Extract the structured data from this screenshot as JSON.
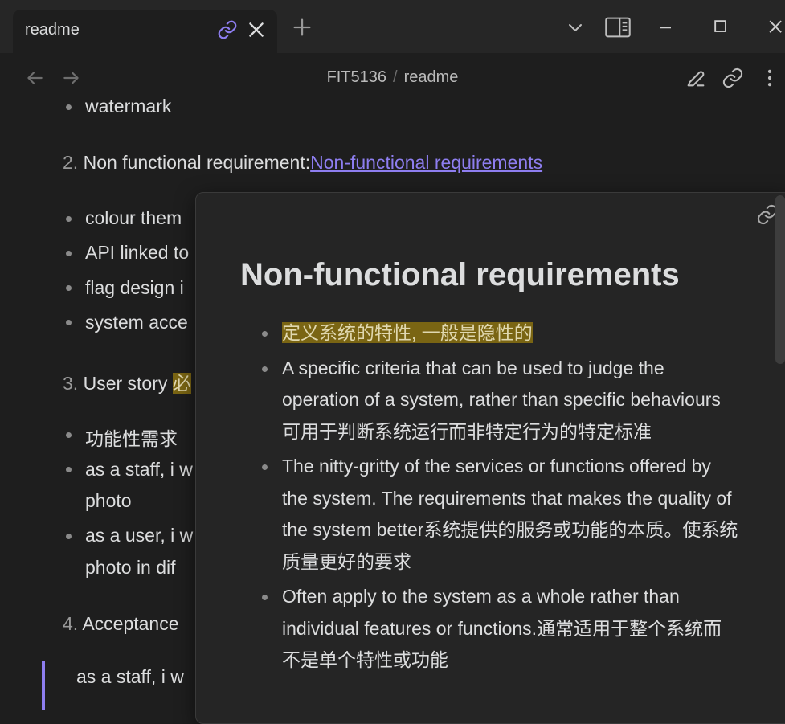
{
  "tab": {
    "title": "readme"
  },
  "breadcrumb": {
    "folder": "FIT5136",
    "separator": "/",
    "file": "readme"
  },
  "note": {
    "bullet_watermark": "watermark",
    "item2_number": "2.",
    "item2_text": "Non functional requirement:",
    "item2_link": "Non-functional requirements",
    "bullets_a": [
      "colour them",
      "API linked to",
      "flag design i",
      "system acce"
    ],
    "item3_number": "3.",
    "item3_text": "User story ",
    "item3_highlight": "必",
    "bullets_b": [
      "功能性需求"
    ],
    "bullet_staff_line1": "as a staff, i w",
    "bullet_staff_line2": "photo",
    "bullet_user_line1": "as a user, i w",
    "bullet_user_line2": "photo in dif",
    "item4_number": "4.",
    "item4_text": "Acceptance",
    "quote_text": "as a staff, i w"
  },
  "preview": {
    "title": "Non-functional requirements",
    "items": [
      "定义系统的特性, 一般是隐性的",
      "A specific criteria that can be used to judge the operation of a system, rather than specific behaviours可用于判断系统运行而非特定行为的特定标准",
      "The nitty-gritty of the services or functions offered by the system. The requirements that makes the quality of the system better系统提供的服务或功能的本质。使系统质量更好的要求",
      "Often apply to the system as a whole rather than individual features or functions.通常适用于整个系统而不是单个特性或功能"
    ]
  },
  "colors": {
    "background": "#1e1e1e",
    "titlebar": "#262626",
    "accent": "#8e7ef0",
    "highlight": "#7a6513",
    "text": "#dcddde"
  },
  "icons": [
    "link-icon",
    "close-icon",
    "plus-icon",
    "chevron-down-icon",
    "sidebar-icon",
    "minimize-icon",
    "maximize-icon",
    "window-close-icon",
    "arrow-left-icon",
    "arrow-right-icon",
    "pencil-icon",
    "more-vertical-icon"
  ]
}
